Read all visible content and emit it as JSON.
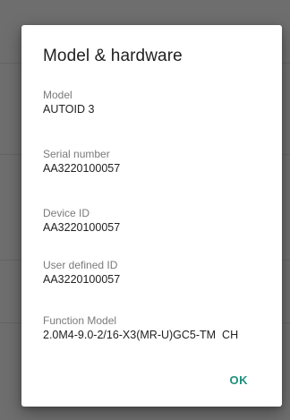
{
  "dialog": {
    "title": "Model & hardware",
    "fields": [
      {
        "label": "Model",
        "value": "AUTOID 3"
      },
      {
        "label": "Serial number",
        "value": "AA3220100057"
      },
      {
        "label": "Device ID",
        "value": "AA3220100057"
      },
      {
        "label": "User defined ID",
        "value": "AA3220100057"
      },
      {
        "label": "Function Model",
        "value": "2.0M4-9.0-2/16-X3(MR-U)GC5-TM  CH"
      }
    ],
    "ok_label": "OK"
  },
  "colors": {
    "accent": "#1d8f7d",
    "scrim": "#6e6e6e"
  }
}
